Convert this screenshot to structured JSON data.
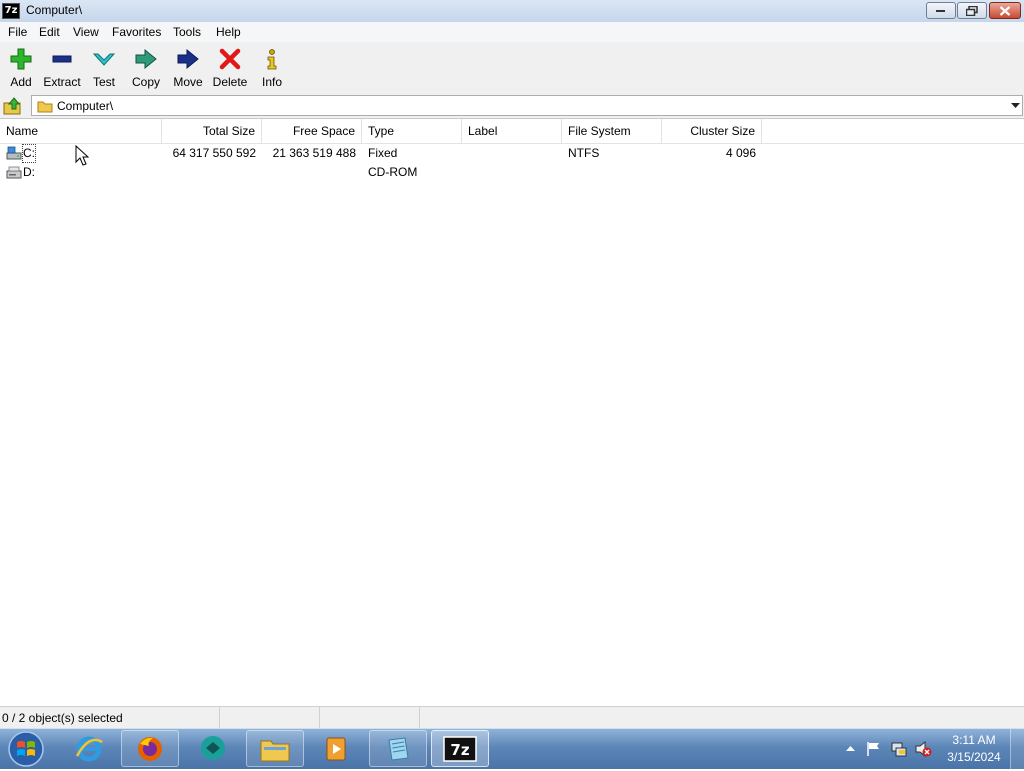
{
  "window": {
    "title": "Computer\\",
    "app_icon_text": "7z"
  },
  "menu": [
    "File",
    "Edit",
    "View",
    "Favorites",
    "Tools",
    "Help"
  ],
  "toolbar": {
    "add": "Add",
    "extract": "Extract",
    "test": "Test",
    "copy": "Copy",
    "move": "Move",
    "delete": "Delete",
    "info": "Info"
  },
  "address": {
    "path": "Computer\\"
  },
  "columns": {
    "name": "Name",
    "total_size": "Total Size",
    "free_space": "Free Space",
    "type": "Type",
    "label": "Label",
    "file_system": "File System",
    "cluster_size": "Cluster Size"
  },
  "rows": [
    {
      "name": "C:",
      "total_size": "64 317 550 592",
      "free_space": "21 363 519 488",
      "type": "Fixed",
      "label": "",
      "file_system": "NTFS",
      "cluster_size": "4 096"
    },
    {
      "name": "D:",
      "total_size": "",
      "free_space": "",
      "type": "CD-ROM",
      "label": "",
      "file_system": "",
      "cluster_size": ""
    }
  ],
  "status": {
    "selection": "0 / 2 object(s) selected"
  },
  "taskbar": {
    "active_app_text": "7z",
    "clock_time": "3:11 AM",
    "clock_date": "3/15/2024"
  },
  "colors": {
    "accent": "#4a73a8",
    "add_green": "#2db52d",
    "delete_red": "#e01818",
    "navy": "#1a2f8a"
  }
}
